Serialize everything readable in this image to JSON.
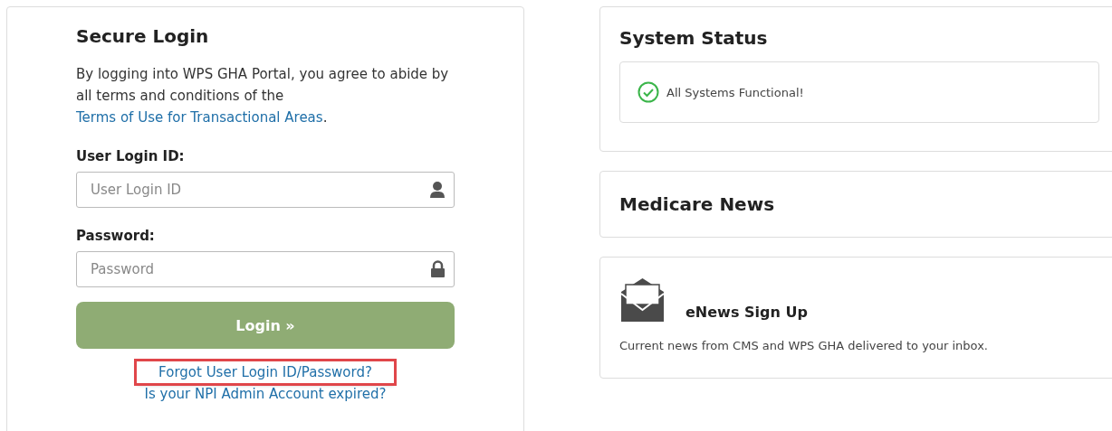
{
  "login": {
    "title": "Secure Login",
    "agreement": {
      "text": "By logging into WPS GHA Portal, you agree to abide by all terms and conditions of the",
      "link": "Terms of Use for Transactional Areas",
      "end": "."
    },
    "fields": [
      {
        "label": "User Login ID:",
        "placeholder": "User Login ID",
        "kind": "user"
      },
      {
        "label": "Password:",
        "placeholder": "Password",
        "kind": "lock"
      }
    ],
    "button": "Login »",
    "links": [
      {
        "text": "Forgot User Login ID/Password?",
        "highlighted": true
      },
      {
        "text": "Is your NPI Admin Account expired?",
        "highlighted": false
      }
    ]
  },
  "system_status": {
    "title": "System Status",
    "message": "All Systems Functional!"
  },
  "medicare_news": {
    "title": "Medicare News"
  },
  "enews": {
    "title": "eNews Sign Up",
    "description": "Current news from CMS and WPS GHA delivered to your inbox."
  }
}
